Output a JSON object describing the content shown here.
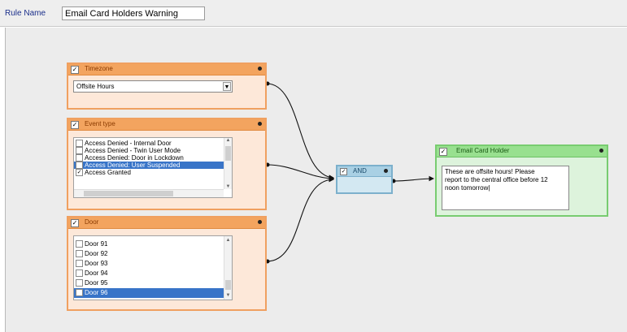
{
  "header": {
    "rule_name_label": "Rule Name",
    "rule_name_value": "Email Card Holders Warning"
  },
  "nodes": {
    "timezone": {
      "title": "Timezone",
      "checked": "✓",
      "selected": "Offsite Hours",
      "dropdown_icon": "chevron-down-icon"
    },
    "event_type": {
      "title": "Event type",
      "checked": "✓",
      "items": [
        {
          "label": "Access Denied - Internal Door",
          "checked": ""
        },
        {
          "label": "Access Denied - Twin User Mode",
          "checked": ""
        },
        {
          "label": "Access Denied: Door in Lockdown",
          "checked": ""
        },
        {
          "label": "Access Denied: User Suspended",
          "checked": "✓",
          "selected": true
        },
        {
          "label": "Access Granted",
          "checked": "✓"
        }
      ]
    },
    "door": {
      "title": "Door",
      "checked": "✓",
      "items": [
        {
          "label": "Door 91",
          "checked": ""
        },
        {
          "label": "Door 92",
          "checked": ""
        },
        {
          "label": "Door 93",
          "checked": ""
        },
        {
          "label": "Door 94",
          "checked": ""
        },
        {
          "label": "Door 95",
          "checked": ""
        },
        {
          "label": "Door 96",
          "checked": "✓",
          "selected": true
        }
      ]
    },
    "and_gate": {
      "title": "AND",
      "checked": "✓"
    },
    "email": {
      "title": "Email Card Holder",
      "checked": "✓",
      "message": "These are offsite hours! Please\nreport to the central office before 12\nnoon tomorrow|"
    }
  },
  "colors": {
    "condition_header": "#f3a45f",
    "condition_border": "#f0a060",
    "and_header": "#a9d0e4",
    "action_header": "#98e08f",
    "selection": "#3874c8"
  }
}
